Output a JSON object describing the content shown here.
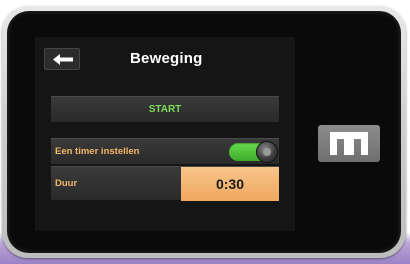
{
  "header": {
    "title": "Beweging",
    "back_icon": "arrow-left-icon"
  },
  "actions": {
    "start_label": "START"
  },
  "settings": {
    "timer_label": "Een timer instellen",
    "timer_enabled": true,
    "duration_label": "Duur",
    "duration_value": "0:30"
  },
  "device": {
    "home_button_icon": "t-logo-icon"
  },
  "colors": {
    "start_text": "#7ddc5a",
    "label_text": "#f2b766",
    "toggle_on": "#4cc236",
    "value_highlight": "#f2b06c"
  }
}
